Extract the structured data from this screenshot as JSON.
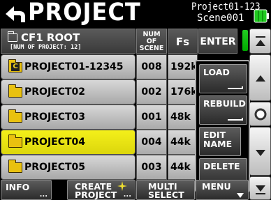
{
  "header": {
    "title": "PROJECT",
    "project_name": "Project01-123",
    "scene_name": "Scene001"
  },
  "table_header": {
    "path": "CF1 ROOT",
    "project_count": "[NUM OF PROJECT: 12]",
    "num_scene": "NUM OF SCENE",
    "fs": "Fs",
    "enter": "ENTER"
  },
  "rows": [
    {
      "name": "PROJECT01-12345",
      "badge": "C",
      "num": "008",
      "fs": "192k",
      "selected": false
    },
    {
      "name": "PROJECT02",
      "num": "002",
      "fs": "176k",
      "selected": false
    },
    {
      "name": "PROJECT03",
      "num": "001",
      "fs": "48k",
      "selected": false
    },
    {
      "name": "PROJECT04",
      "num": "004",
      "fs": "44k",
      "selected": true
    },
    {
      "name": "PROJECT05",
      "num": "003",
      "fs": "44k",
      "selected": false
    }
  ],
  "popup_menu": {
    "load": "LOAD",
    "rebuild": "REBUILD",
    "edit_name": "EDIT NAME",
    "delete": "DELETE"
  },
  "bottom_bar": {
    "info": "INFO",
    "create_project": "CREATE PROJECT",
    "multi_select": "MULTI SELECT",
    "menu": "MENU"
  },
  "colors": {
    "selected_row": "#f0ea14",
    "folder": "#e9c10f",
    "scroll_thumb": "#22cc22"
  },
  "icons": {
    "back": "back-arrow-icon",
    "battery": "battery-icon",
    "folder": "folder-icon",
    "star": "sparkle-icon"
  }
}
